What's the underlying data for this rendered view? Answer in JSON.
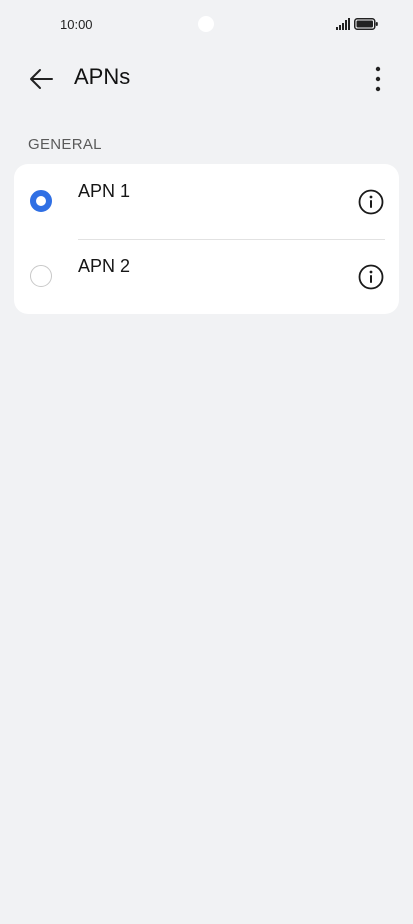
{
  "status_bar": {
    "time": "10:00",
    "signal_icon": "signal-icon",
    "battery_icon": "battery-icon"
  },
  "header": {
    "back_icon": "arrow-left-icon",
    "title": "APNs",
    "more_icon": "more-vertical-icon"
  },
  "section": {
    "title": "GENERAL",
    "items": [
      {
        "label": "APN 1",
        "selected": true,
        "info_icon": "info-icon"
      },
      {
        "label": "APN 2",
        "selected": false,
        "info_icon": "info-icon"
      }
    ]
  },
  "colors": {
    "accent": "#2f6fe4",
    "background": "#f1f2f4",
    "card": "#ffffff"
  }
}
